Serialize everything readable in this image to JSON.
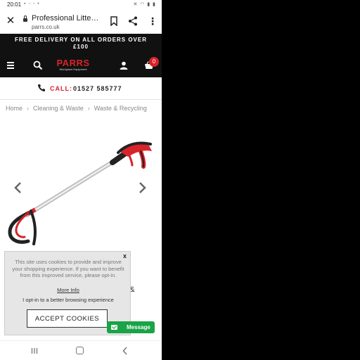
{
  "status_bar": {
    "time": "20:01"
  },
  "browser": {
    "page_title": "Professional Litter Pi...",
    "url": "parrs.co.uk"
  },
  "banner": {
    "line1": "FREE DELIVERY ON ALL ORDERS OVER",
    "line2": "£100"
  },
  "header": {
    "logo_text": "PARRS",
    "logo_tagline": "Workplace Equipment",
    "cart_count": "0"
  },
  "call_strip": {
    "label": "CALL:",
    "number": "01527 585777"
  },
  "breadcrumb": [
    "Home",
    "Cleaning & Waste",
    "Waste & Recycling"
  ],
  "product": {
    "title_fragment": "m &"
  },
  "cookie_popup": {
    "close": "x",
    "message": "This site uses cookies to provide and improve your shopping experience. If you want to benefit from this improved service, please opt-in.",
    "more_info": "More Info",
    "opt_in": "I opt-in to a better browsing experience",
    "accept": "ACCEPT COOKIES"
  },
  "chat": {
    "label": "Message"
  },
  "colors": {
    "brand_red": "#d8232a",
    "chat_green": "#1aa347",
    "header_black": "#111111"
  }
}
